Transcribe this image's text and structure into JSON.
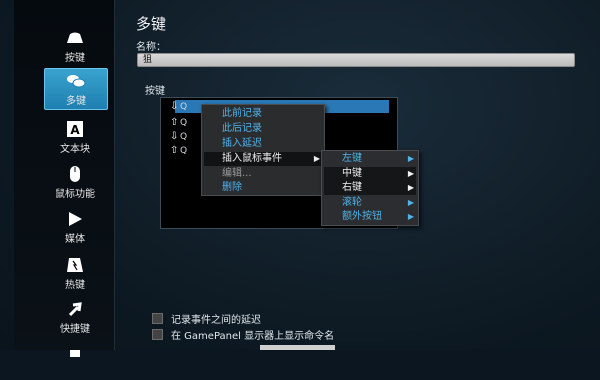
{
  "title": "多键",
  "name_label": "名称：",
  "name_value": "狙",
  "keys_label": "按键",
  "sidebar": {
    "items": [
      {
        "label": "按键",
        "icon": "mouse-icon"
      },
      {
        "label": "多键",
        "icon": "multikey-icon"
      },
      {
        "label": "文本块",
        "icon": "letter-a-icon"
      },
      {
        "label": "鼠标功能",
        "icon": "mouse-function-icon"
      },
      {
        "label": "媒体",
        "icon": "play-icon"
      },
      {
        "label": "热键",
        "icon": "hotkey-icon"
      },
      {
        "label": "快捷键",
        "icon": "shortcut-arrow-icon"
      }
    ]
  },
  "key_list": {
    "rows": [
      {
        "arrow": "⇩",
        "text": "Q"
      },
      {
        "arrow": "⇧",
        "text": "Q"
      },
      {
        "arrow": "⇩",
        "text": "Q"
      },
      {
        "arrow": "⇧",
        "text": "Q"
      }
    ]
  },
  "context_menu": {
    "items": [
      {
        "label": "此前记录",
        "style": "blue"
      },
      {
        "label": "此后记录",
        "style": "blue"
      },
      {
        "label": "插入延迟",
        "style": "blue"
      },
      {
        "label": "插入鼠标事件",
        "style": "white",
        "submenu": "▶"
      },
      {
        "label": "编辑...",
        "style": "gray"
      },
      {
        "label": "删除",
        "style": "blue"
      }
    ]
  },
  "submenu": {
    "items": [
      {
        "label": "左键",
        "style": "blue",
        "arrow": "▶"
      },
      {
        "label": "中键",
        "style": "white",
        "arrow": "▶"
      },
      {
        "label": "右键",
        "style": "white",
        "arrow": "▶"
      },
      {
        "label": "滚轮",
        "style": "blue",
        "arrow": "▶"
      },
      {
        "label": "额外按钮",
        "style": "blue",
        "arrow": "▶"
      }
    ]
  },
  "options": {
    "record_delay": "记录事件之间的延迟",
    "show_on_gamepanel": "在 GamePanel 显示器上显示命令名"
  },
  "colors": {
    "accent": "#2a79b6",
    "menu_blue": "#4fb3ea",
    "active_tab": "#3aa3cf"
  }
}
